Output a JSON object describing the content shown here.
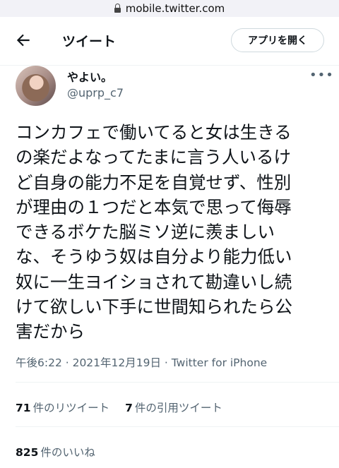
{
  "browser": {
    "url": "mobile.twitter.com"
  },
  "header": {
    "title": "ツイート",
    "open_app_label": "アプリを開く"
  },
  "tweet": {
    "display_name": "やよい。",
    "handle": "@uprp_c7",
    "text": "コンカフェで働いてると女は生きる\nの楽だよなってたまに言う人いるけ\nど自身の能力不足を自覚せず、性別\nが理由の１つだと本気で思って侮辱\nできるボケた脳ミソ逆に羨ましい\nな、そうゆう奴は自分より能力低い\n奴に一生ヨイショされて勘違いし続\nけて欲しい下手に世間知られたら公\n害だから",
    "meta": "午後6:22 · 2021年12月19日 · Twitter for iPhone",
    "retweets": {
      "count": "71",
      "label": "件のリツイート"
    },
    "quotes": {
      "count": "7",
      "label": "件の引用ツイート"
    },
    "likes": {
      "count": "825",
      "label": "件のいいね"
    }
  },
  "icons": {
    "lock": "lock-icon",
    "back": "back-arrow-icon",
    "more": "more-icon"
  }
}
